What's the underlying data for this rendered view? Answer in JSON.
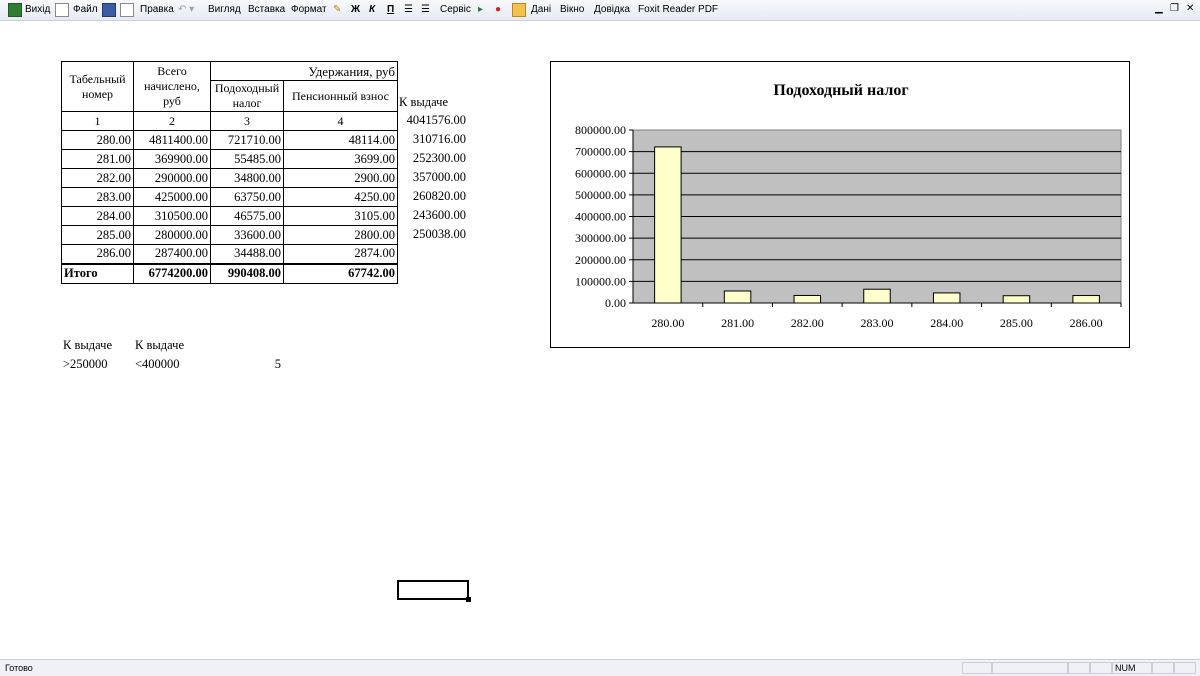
{
  "menu": {
    "items": [
      "Вихід",
      "Файл",
      "Правка",
      "Вигляд",
      "Вставка",
      "Формат",
      "Сервіс",
      "Дані",
      "Вікно",
      "Довідка",
      "Foxit Reader PDF"
    ],
    "format_bold": "Ж",
    "format_italic": "К",
    "format_underline": "П"
  },
  "table": {
    "header_tab": "Табельный номер",
    "header_total": "Всего начислено, руб",
    "header_deductions": "Удержания, руб",
    "header_income_tax": "Подоходный налог",
    "header_pension": "Пенсионный взнос",
    "col_numbers": [
      "1",
      "2",
      "3",
      "4"
    ],
    "payout_label": "К выдаче",
    "rows": [
      {
        "id": "280.00",
        "total": "4811400.00",
        "tax": "721710.00",
        "pension": "48114.00",
        "payout": "4041576.00"
      },
      {
        "id": "281.00",
        "total": "369900.00",
        "tax": "55485.00",
        "pension": "3699.00",
        "payout": "310716.00"
      },
      {
        "id": "282.00",
        "total": "290000.00",
        "tax": "34800.00",
        "pension": "2900.00",
        "payout": "252300.00"
      },
      {
        "id": "283.00",
        "total": "425000.00",
        "tax": "63750.00",
        "pension": "4250.00",
        "payout": "357000.00"
      },
      {
        "id": "284.00",
        "total": "310500.00",
        "tax": "46575.00",
        "pension": "3105.00",
        "payout": "260820.00"
      },
      {
        "id": "285.00",
        "total": "280000.00",
        "tax": "33600.00",
        "pension": "2800.00",
        "payout": "243600.00"
      },
      {
        "id": "286.00",
        "total": "287400.00",
        "tax": "34488.00",
        "pension": "2874.00",
        "payout": "250038.00"
      }
    ],
    "totals": {
      "label": "Итого",
      "total": "6774200.00",
      "tax": "990408.00",
      "pension": "67742.00"
    }
  },
  "criteria": {
    "label1": "К выдаче",
    "label2": "К выдаче",
    "cond1": ">250000",
    "cond2": "<400000",
    "result": "5"
  },
  "status": {
    "ready": "Готово",
    "num": "NUM"
  },
  "chart_data": {
    "type": "bar",
    "title": "Подоходный налог",
    "categories": [
      "280.00",
      "281.00",
      "282.00",
      "283.00",
      "284.00",
      "285.00",
      "286.00"
    ],
    "values": [
      721710,
      55485,
      34800,
      63750,
      46575,
      33600,
      34488
    ],
    "ylim": [
      0,
      800000
    ],
    "yticks": [
      "0.00",
      "100000.00",
      "200000.00",
      "300000.00",
      "400000.00",
      "500000.00",
      "600000.00",
      "700000.00",
      "800000.00"
    ],
    "grid": true,
    "legend": "none",
    "bar_color": "#ffffcc",
    "plot_bg": "#c0c0c0"
  }
}
